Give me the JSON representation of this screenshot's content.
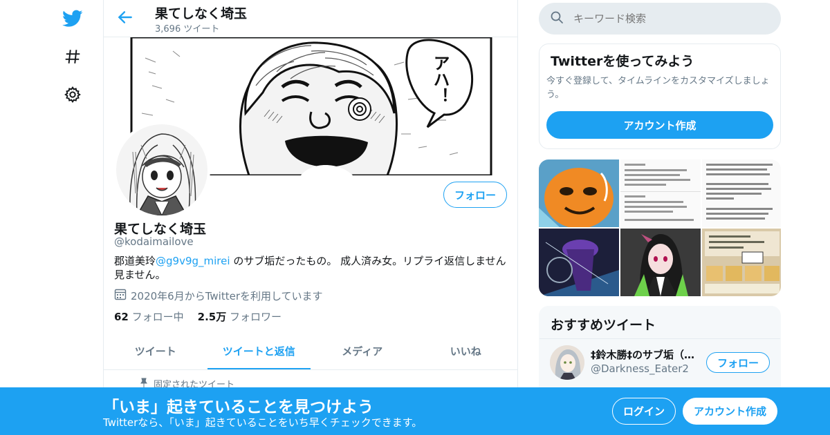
{
  "colors": {
    "accent": "#1da1f2",
    "muted": "#657786",
    "divider": "#e6ecf0",
    "panel": "#f5f8fa"
  },
  "nav": {
    "icons": [
      "twitter-logo-icon",
      "hashtag-icon",
      "gear-icon"
    ]
  },
  "header": {
    "name": "果てしなく埼玉",
    "tweet_count": "3,696 ツイート"
  },
  "banner": {
    "speech_bubble_text": "アハ！"
  },
  "profile": {
    "name": "果てしなく埼玉",
    "handle": "@kodaimailove",
    "follow_label": "フォロー",
    "bio_prefix": "郡道美玲",
    "bio_mention": "@g9v9g_mirei",
    "bio_suffix": " のサブ垢だったもの。 成人済み女。リプライ返信しません見ません。",
    "joined": "2020年6月からTwitterを利用しています",
    "following_count": "62",
    "following_label": "フォロー中",
    "followers_count": "2.5万",
    "followers_label": "フォロワー"
  },
  "tabs": [
    {
      "label": "ツイート",
      "active": false
    },
    {
      "label": "ツイートと返信",
      "active": true
    },
    {
      "label": "メディア",
      "active": false
    },
    {
      "label": "いいね",
      "active": false
    }
  ],
  "pinned_label": "固定されたツイート",
  "search": {
    "placeholder": "キーワード検索"
  },
  "signup_card": {
    "title": "Twitterを使ってみよう",
    "description": "今すぐ登録して、タイムラインをカスタマイズしましょう。",
    "button": "アカウント作成"
  },
  "media_thumbs": [
    "orange-character",
    "text-screenshot",
    "text-screenshot-2",
    "purple-figure",
    "anime-character",
    "snack-packages"
  ],
  "recommended": {
    "title": "おすすめツイート",
    "user_name": "‡鈴木勝‡のサブ垢（…",
    "user_handle": "@Darkness_Eater2",
    "follow_label": "フォロー"
  },
  "bottom_bar": {
    "title": "「いま」起きていることを見つけよう",
    "subtitle": "Twitterなら、「いま」起きていることをいち早くチェックできます。",
    "login": "ログイン",
    "signup": "アカウント作成"
  }
}
